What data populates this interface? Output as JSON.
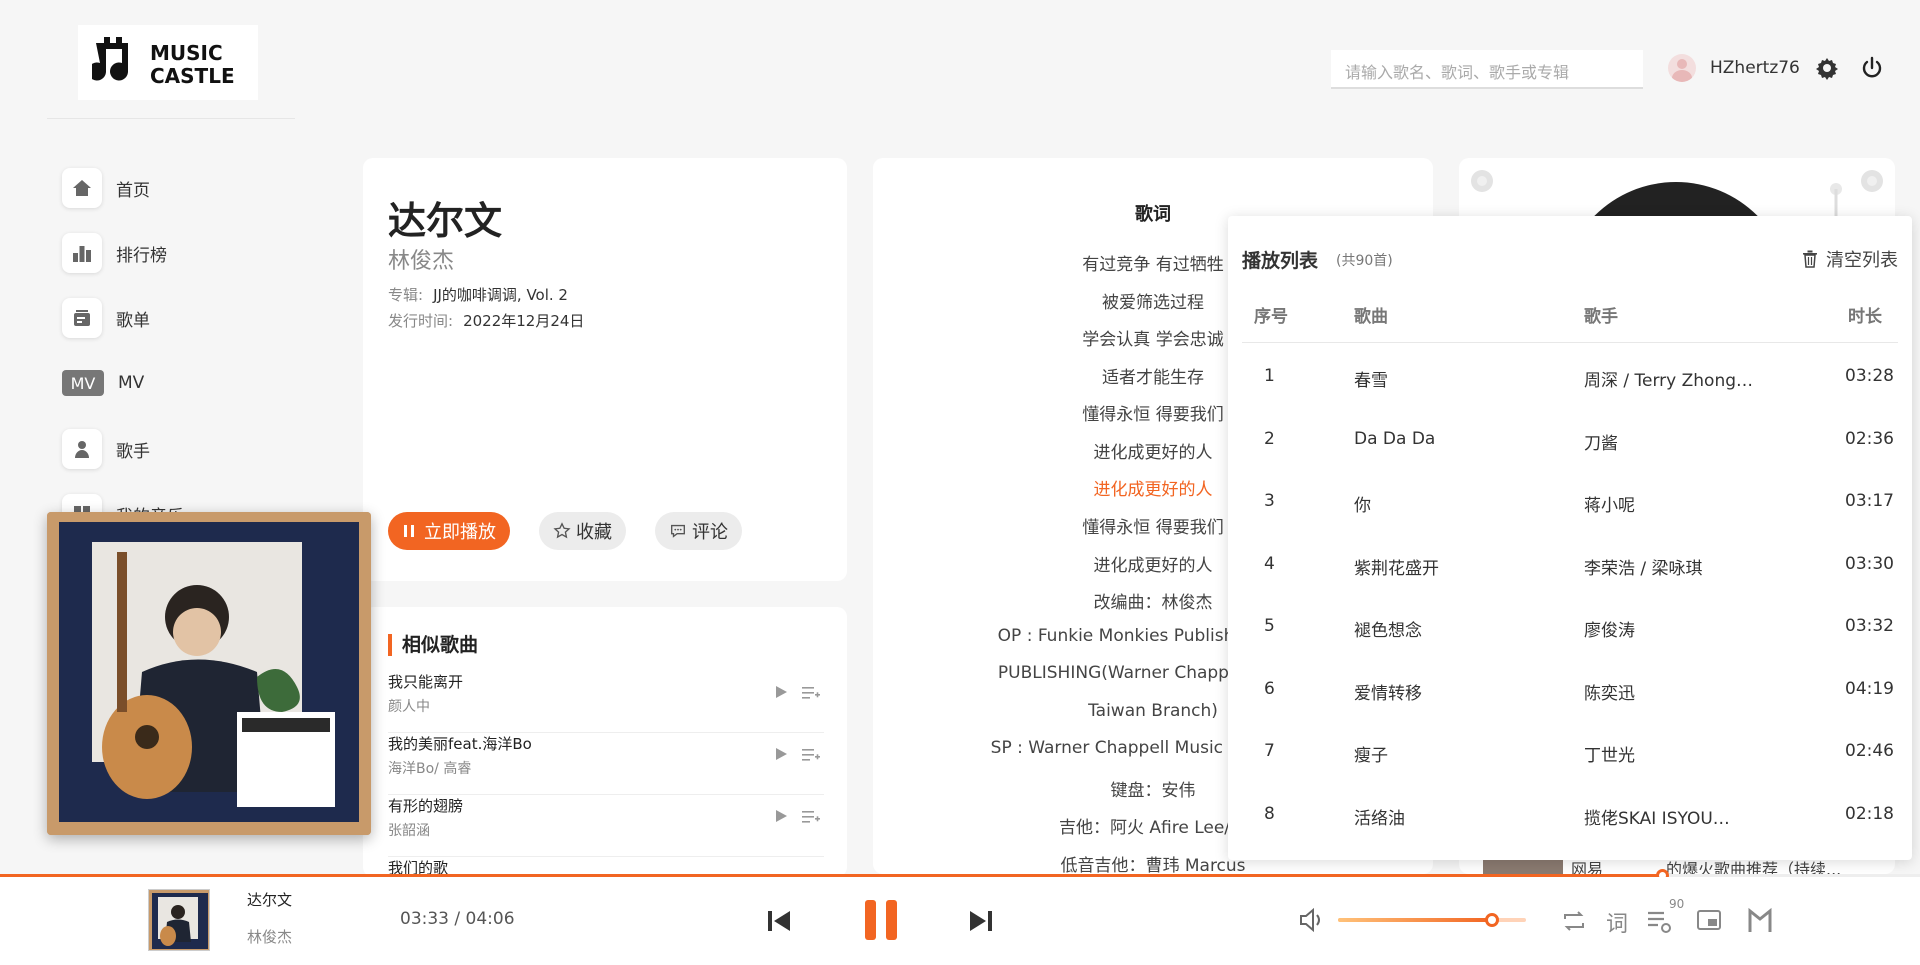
{
  "app": {
    "logo_text": "MUSIC CASTLE",
    "search_placeholder": "请输入歌名、歌词、歌手或专辑",
    "username": "HZhertz76"
  },
  "sidebar": {
    "items": [
      {
        "label": "首页",
        "icon": "home-icon"
      },
      {
        "label": "排行榜",
        "icon": "chart-icon"
      },
      {
        "label": "歌单",
        "icon": "playlist-icon"
      },
      {
        "label": "MV",
        "icon": "mv-icon",
        "badge": "MV"
      },
      {
        "label": "歌手",
        "icon": "singer-icon"
      },
      {
        "label": "我的音乐",
        "icon": "my-music-icon"
      }
    ]
  },
  "song": {
    "title": "达尔文",
    "artist": "林俊杰",
    "album_label": "专辑:",
    "album": "JJ的咖啡调调, Vol. 2",
    "release_label": "发行时间:",
    "release": "2022年12月24日",
    "play_label": "立即播放",
    "collect_label": "收藏",
    "comment_label": "评论"
  },
  "similar": {
    "title": "相似歌曲",
    "items": [
      {
        "name": "我只能离开",
        "artist": "颜人中"
      },
      {
        "name": "我的美丽feat.海洋Bo",
        "artist": "海洋Bo/ 高睿"
      },
      {
        "name": "有形的翅膀",
        "artist": "张韶涵"
      },
      {
        "name": "我们的歌",
        "artist": ""
      }
    ]
  },
  "lyrics": {
    "title": "歌词",
    "lines": [
      "有过竞争 有过牺牲",
      "被爱筛选过程",
      "学会认真 学会忠诚",
      "适者才能生存",
      "懂得永恒 得要我们",
      "进化成更好的人",
      "进化成更好的人",
      "懂得永恒 得要我们",
      "进化成更好的人",
      "改编曲：林俊杰",
      "OP : Funkie Monkies Publishing Pte L",
      "PUBLISHING(Warner Chappell Music,",
      "Taiwan Branch)",
      "SP : Warner Chappell Music Publishing",
      "键盘：安伟",
      "吉他：阿火 Afire Lee/黄",
      "低音吉他：曹玮 Marcus"
    ],
    "active_index": 6
  },
  "right_card": {
    "peek_text": "网易",
    "peek_text2": "的爆火歌曲推荐（持续..."
  },
  "playlist": {
    "title": "播放列表",
    "count": "(共90首)",
    "clear_label": "清空列表",
    "columns": [
      "序号",
      "歌曲",
      "歌手",
      "时长"
    ],
    "rows": [
      {
        "no": "1",
        "song": "春雪",
        "artist": "周深 / Terry Zhong…",
        "duration": "03:28"
      },
      {
        "no": "2",
        "song": "Da Da Da",
        "artist": "刀酱",
        "duration": "02:36"
      },
      {
        "no": "3",
        "song": "你",
        "artist": "蒋小呢",
        "duration": "03:17"
      },
      {
        "no": "4",
        "song": "紫荆花盛开",
        "artist": "李荣浩 / 梁咏琪",
        "duration": "03:30"
      },
      {
        "no": "5",
        "song": "褪色想念",
        "artist": "廖俊涛",
        "duration": "03:32"
      },
      {
        "no": "6",
        "song": "爱情转移",
        "artist": "陈奕迅",
        "duration": "04:19"
      },
      {
        "no": "7",
        "song": "瘦子",
        "artist": "丁世光",
        "duration": "02:46"
      },
      {
        "no": "8",
        "song": "活络油",
        "artist": "揽佬SKAI ISYOU…",
        "duration": "02:18"
      }
    ]
  },
  "player": {
    "title": "达尔文",
    "artist": "林俊杰",
    "time": "03:33 / 04:06",
    "progress": 0.866,
    "volume": 0.82,
    "lyric_toggle": "词",
    "playlist_count": "90"
  },
  "colors": {
    "accent": "#f26522",
    "text": "#333333",
    "muted": "#888888"
  }
}
